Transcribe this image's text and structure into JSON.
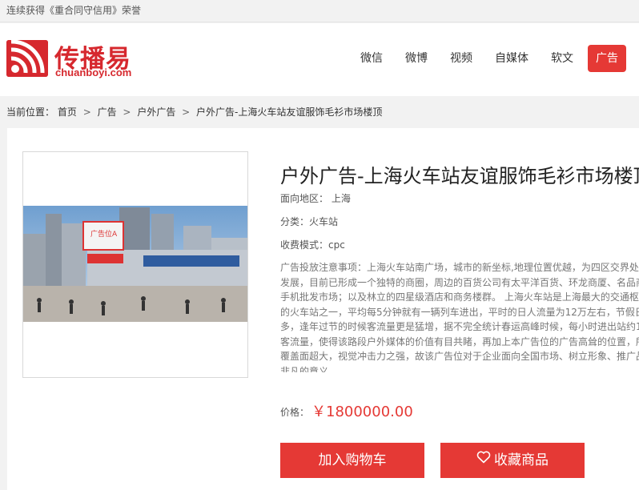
{
  "topbar": {
    "notice": "连续获得《重合同守信用》荣誉"
  },
  "logo": {
    "brand_cn": "传播易",
    "domain": "chuanboyi.com"
  },
  "nav": {
    "items": [
      {
        "label": "微信"
      },
      {
        "label": "微博"
      },
      {
        "label": "视频"
      },
      {
        "label": "自媒体"
      },
      {
        "label": "软文"
      },
      {
        "label": "广告",
        "active": true
      }
    ]
  },
  "breadcrumb": {
    "prefix": "当前位置：",
    "items": [
      "首页",
      "广告",
      "户外广告",
      "户外广告-上海火车站友谊服饰毛衫市场楼顶"
    ],
    "separator": ">"
  },
  "product": {
    "title": "户外广告-上海火车站友谊服饰毛衫市场楼顶",
    "region": "面向地区：  上海",
    "category": "分类：火车站",
    "billing": "收费模式：cpc",
    "description_lines": [
      "广告投放注意事项：上海火车站南广场，城市的新坐标,地理位置优越，为四区交界处，",
      "发展，目前已形成一个独特的商圈，周边的百货公司有太平洋百货、环龙商厦、名品商",
      "手机批发市场；以及林立的四星级酒店和商务楼群。 上海火车站是上海最大的交通枢",
      "的火车站之一，平均每5分钟就有一辆列车进出，平时的日人流量为12万左右，节假日",
      "多，逢年过节的时候客流量更是猛增，据不完全统计春运高峰时候，每小时进出站约1",
      "客流量，使得该路段户外媒体的价值有目共睹，再加上本广告位的广告高耸的位置，所",
      "覆盖面超大，视觉冲击力之强，故该广告位对于企业面向全国市场、树立形象、推广品",
      "非凡的意义。"
    ],
    "billboard_text": "广告位A",
    "price_label": "价格：",
    "price": "￥1800000.00"
  },
  "actions": {
    "add_to_cart": "加入购物车",
    "favorite": "收藏商品"
  },
  "colors": {
    "accent": "#e53935",
    "brand": "#d6282e"
  }
}
